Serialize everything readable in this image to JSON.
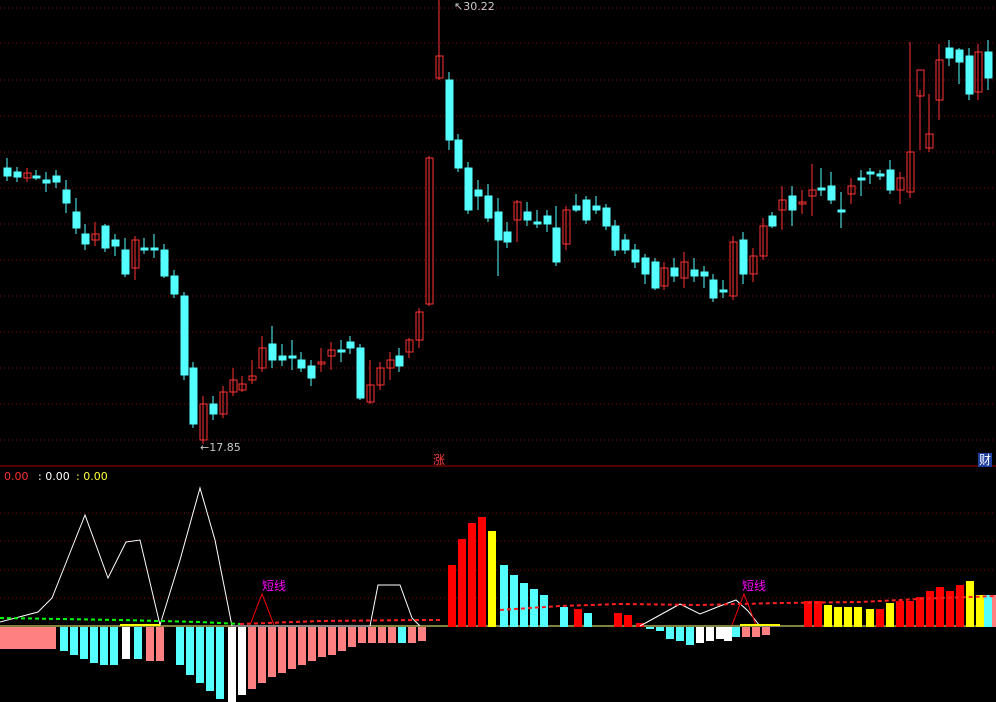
{
  "colors": {
    "up": "#ff3232",
    "down": "#54ffff",
    "grid": "#8b0000",
    "macd_pos": "#ff0000",
    "macd_pos_yellow": "#ffff00",
    "macd_neg": "#ff8080",
    "macd_neg_cyan": "#54ffff",
    "macd_neg_white": "#ffffff",
    "white_line": "#ffffff",
    "signal_dash": "#ff2020",
    "green_dash": "#00ff00",
    "zero_line": "#ffff80",
    "annotation": "#ff00ff"
  },
  "labels": {
    "high": "30.22",
    "low": "17.85",
    "zhang_marker": "涨",
    "cai_marker": "财",
    "indicator_values": [
      "0.00",
      ": 0.00",
      ": 0.00"
    ],
    "annotation": "短线"
  },
  "chart_data": [
    {
      "type": "candlestick",
      "price_range": [
        17.85,
        30.22
      ],
      "high_label": "30.22",
      "low_label": "17.85",
      "candles_ohlc_pixel_trace": [
        [
          168,
          176,
          158,
          181
        ],
        [
          172,
          177,
          167,
          182
        ],
        [
          178,
          173,
          168,
          182
        ],
        [
          176,
          176,
          170,
          180
        ],
        [
          180,
          183,
          172,
          192
        ],
        [
          176,
          182,
          170,
          188
        ],
        [
          190,
          203,
          180,
          213
        ],
        [
          212,
          228,
          198,
          234
        ],
        [
          234,
          244,
          224,
          250
        ],
        [
          240,
          234,
          222,
          246
        ],
        [
          226,
          248,
          224,
          252
        ],
        [
          240,
          246,
          234,
          256
        ],
        [
          250,
          274,
          238,
          277
        ],
        [
          268,
          240,
          236,
          280
        ],
        [
          248,
          248,
          238,
          254
        ],
        [
          248,
          250,
          234,
          258
        ],
        [
          250,
          276,
          244,
          278
        ],
        [
          276,
          294,
          270,
          298
        ],
        [
          296,
          375,
          292,
          380
        ],
        [
          368,
          424,
          362,
          428
        ],
        [
          440,
          404,
          396,
          444
        ],
        [
          404,
          414,
          396,
          420
        ],
        [
          414,
          392,
          386,
          418
        ],
        [
          392,
          380,
          368,
          396
        ],
        [
          390,
          384,
          376,
          392
        ],
        [
          380,
          376,
          360,
          384
        ],
        [
          368,
          348,
          336,
          372
        ],
        [
          344,
          360,
          326,
          368
        ],
        [
          356,
          360,
          344,
          366
        ],
        [
          356,
          358,
          340,
          370
        ],
        [
          360,
          368,
          352,
          372
        ],
        [
          366,
          378,
          360,
          386
        ],
        [
          364,
          362,
          348,
          372
        ],
        [
          356,
          350,
          342,
          370
        ],
        [
          350,
          350,
          340,
          362
        ],
        [
          342,
          348,
          336,
          354
        ],
        [
          348,
          398,
          344,
          400
        ],
        [
          402,
          385,
          360,
          404
        ],
        [
          385,
          368,
          362,
          390
        ],
        [
          368,
          360,
          352,
          380
        ],
        [
          356,
          366,
          348,
          372
        ],
        [
          352,
          340,
          338,
          358
        ],
        [
          340,
          312,
          308,
          348
        ],
        [
          304,
          158,
          156,
          306
        ],
        [
          78,
          56,
          0,
          80
        ],
        [
          80,
          140,
          72,
          150
        ],
        [
          140,
          168,
          134,
          172
        ],
        [
          168,
          210,
          162,
          214
        ],
        [
          190,
          196,
          180,
          210
        ],
        [
          196,
          218,
          184,
          222
        ],
        [
          212,
          240,
          198,
          276
        ],
        [
          232,
          242,
          222,
          248
        ],
        [
          220,
          202,
          200,
          242
        ],
        [
          212,
          220,
          202,
          226
        ],
        [
          222,
          222,
          210,
          228
        ],
        [
          216,
          224,
          210,
          232
        ],
        [
          228,
          262,
          206,
          266
        ],
        [
          244,
          210,
          206,
          250
        ],
        [
          206,
          210,
          194,
          212
        ],
        [
          200,
          220,
          196,
          224
        ],
        [
          206,
          210,
          196,
          214
        ],
        [
          208,
          226,
          204,
          230
        ],
        [
          226,
          250,
          220,
          256
        ],
        [
          240,
          250,
          234,
          254
        ],
        [
          250,
          262,
          244,
          268
        ],
        [
          258,
          274,
          254,
          284
        ],
        [
          262,
          288,
          258,
          290
        ],
        [
          286,
          268,
          262,
          290
        ],
        [
          268,
          276,
          258,
          282
        ],
        [
          278,
          262,
          252,
          288
        ],
        [
          270,
          276,
          258,
          282
        ],
        [
          272,
          276,
          266,
          288
        ],
        [
          280,
          298,
          274,
          302
        ],
        [
          290,
          290,
          280,
          298
        ],
        [
          296,
          242,
          236,
          300
        ],
        [
          240,
          274,
          232,
          284
        ],
        [
          274,
          256,
          248,
          282
        ],
        [
          256,
          226,
          218,
          260
        ],
        [
          216,
          226,
          212,
          228
        ],
        [
          210,
          200,
          186,
          230
        ],
        [
          196,
          210,
          186,
          226
        ],
        [
          204,
          202,
          190,
          214
        ],
        [
          196,
          190,
          164,
          216
        ],
        [
          188,
          190,
          168,
          196
        ],
        [
          186,
          200,
          172,
          204
        ],
        [
          210,
          212,
          192,
          228
        ],
        [
          194,
          186,
          178,
          204
        ],
        [
          178,
          180,
          170,
          196
        ],
        [
          172,
          174,
          168,
          184
        ],
        [
          174,
          176,
          170,
          180
        ],
        [
          170,
          190,
          160,
          194
        ],
        [
          190,
          178,
          172,
          204
        ],
        [
          192,
          152,
          42,
          198
        ],
        [
          96,
          70,
          90,
          150
        ],
        [
          148,
          134,
          94,
          152
        ],
        [
          100,
          60,
          44,
          120
        ],
        [
          48,
          58,
          40,
          66
        ],
        [
          50,
          62,
          48,
          84
        ],
        [
          56,
          94,
          48,
          100
        ],
        [
          92,
          52,
          44,
          100
        ],
        [
          52,
          78,
          40,
          90
        ]
      ]
    },
    {
      "type": "bar",
      "legend": [
        "0.00",
        ": 0.00",
        ": 0.00"
      ],
      "annotations": [
        "短线",
        "短线"
      ],
      "histogram_top": [
        [
          0,
          -22,
          "neg"
        ],
        [
          8,
          -22,
          "neg"
        ],
        [
          16,
          -22,
          "neg"
        ],
        [
          24,
          -22,
          "neg"
        ],
        [
          32,
          -22,
          "neg"
        ],
        [
          40,
          -22,
          "neg"
        ],
        [
          48,
          -22,
          "neg"
        ],
        [
          60,
          -24,
          "cyan"
        ],
        [
          70,
          -28,
          "cyan"
        ],
        [
          80,
          -32,
          "cyan"
        ],
        [
          90,
          -36,
          "cyan"
        ],
        [
          100,
          -38,
          "cyan"
        ],
        [
          110,
          -38,
          "cyan"
        ],
        [
          122,
          -32,
          "white"
        ],
        [
          134,
          -32,
          "cyan"
        ],
        [
          146,
          -34,
          "neg"
        ],
        [
          156,
          -34,
          "neg"
        ],
        [
          176,
          -38,
          "cyan"
        ],
        [
          186,
          -48,
          "cyan"
        ],
        [
          196,
          -56,
          "cyan"
        ],
        [
          206,
          -64,
          "cyan"
        ],
        [
          216,
          -72,
          "cyan"
        ],
        [
          228,
          -76,
          "white"
        ],
        [
          238,
          -68,
          "white"
        ],
        [
          248,
          -62,
          "neg"
        ],
        [
          258,
          -56,
          "neg"
        ],
        [
          268,
          -50,
          "neg"
        ],
        [
          278,
          -46,
          "neg"
        ],
        [
          288,
          -42,
          "neg"
        ],
        [
          298,
          -38,
          "neg"
        ],
        [
          308,
          -34,
          "neg"
        ],
        [
          318,
          -30,
          "neg"
        ],
        [
          328,
          -28,
          "neg"
        ],
        [
          338,
          -24,
          "neg"
        ],
        [
          348,
          -20,
          "neg"
        ],
        [
          358,
          -16,
          "neg"
        ],
        [
          368,
          -16,
          "neg"
        ],
        [
          378,
          -16,
          "neg"
        ],
        [
          388,
          -16,
          "neg"
        ],
        [
          398,
          -16,
          "cyan"
        ],
        [
          408,
          -16,
          "neg"
        ],
        [
          418,
          -14,
          "neg"
        ],
        [
          448,
          62,
          "pos"
        ],
        [
          458,
          88,
          "pos"
        ],
        [
          468,
          104,
          "pos"
        ],
        [
          478,
          110,
          "pos"
        ],
        [
          488,
          96,
          "yellow"
        ],
        [
          500,
          62,
          "cyan"
        ],
        [
          510,
          52,
          "cyan"
        ],
        [
          520,
          44,
          "cyan"
        ],
        [
          530,
          38,
          "cyan"
        ],
        [
          540,
          32,
          "cyan"
        ],
        [
          560,
          20,
          "cyan"
        ],
        [
          574,
          18,
          "pos"
        ],
        [
          584,
          14,
          "cyan"
        ],
        [
          614,
          14,
          "pos"
        ],
        [
          624,
          12,
          "pos"
        ],
        [
          636,
          4,
          "pos"
        ],
        [
          646,
          0,
          "cyan"
        ],
        [
          656,
          -4,
          "cyan"
        ],
        [
          666,
          -12,
          "cyan"
        ],
        [
          676,
          -14,
          "cyan"
        ],
        [
          686,
          -18,
          "cyan"
        ],
        [
          696,
          -16,
          "white"
        ],
        [
          706,
          -14,
          "white"
        ],
        [
          716,
          -12,
          "white"
        ],
        [
          724,
          -14,
          "white"
        ],
        [
          732,
          -10,
          "cyan"
        ],
        [
          742,
          -10,
          "neg"
        ],
        [
          752,
          -10,
          "neg"
        ],
        [
          762,
          -8,
          "neg"
        ],
        [
          804,
          26,
          "pos"
        ],
        [
          814,
          26,
          "pos"
        ],
        [
          824,
          22,
          "yellow"
        ],
        [
          834,
          20,
          "yellow"
        ],
        [
          844,
          20,
          "yellow"
        ],
        [
          854,
          20,
          "yellow"
        ],
        [
          866,
          18,
          "yellow"
        ],
        [
          876,
          18,
          "pos"
        ],
        [
          886,
          24,
          "yellow"
        ],
        [
          896,
          26,
          "pos"
        ],
        [
          906,
          26,
          "pos"
        ],
        [
          916,
          30,
          "pos"
        ],
        [
          926,
          36,
          "pos"
        ],
        [
          936,
          40,
          "pos"
        ],
        [
          946,
          36,
          "pos"
        ],
        [
          956,
          42,
          "pos"
        ],
        [
          966,
          46,
          "yellow"
        ],
        [
          976,
          32,
          "yellow"
        ],
        [
          984,
          32,
          "cyan"
        ],
        [
          992,
          32,
          "neg"
        ]
      ]
    }
  ]
}
